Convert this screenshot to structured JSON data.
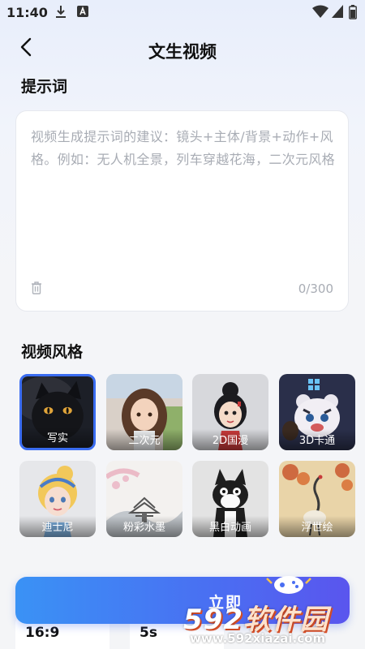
{
  "status_bar": {
    "time": "11:40"
  },
  "header": {
    "title": "文生视频"
  },
  "prompt": {
    "section_title": "提示词",
    "placeholder": "视频生成提示词的建议：镜头+主体/背景+动作+风格。例如：无人机全景，列车穿越花海，二次元风格",
    "char_count": "0/300"
  },
  "video_style": {
    "section_title": "视频风格",
    "selected": "写实",
    "items": [
      {
        "label": "写实"
      },
      {
        "label": "二次元"
      },
      {
        "label": "2D国漫"
      },
      {
        "label": "3D卡通"
      },
      {
        "label": "迪士尼"
      },
      {
        "label": "粉彩水墨"
      },
      {
        "label": "黑白动画"
      },
      {
        "label": "浮世绘"
      }
    ]
  },
  "bottom": {
    "create_label": "立即",
    "ratio_value": "16:9",
    "duration_value": "5s"
  },
  "watermark": {
    "logo_num": "592",
    "logo_name": "软件园",
    "url": "www.592xiazai.com"
  },
  "colors": {
    "accent": "#3a6cf0",
    "button_start": "#3a92f5",
    "button_end": "#5a55ee"
  }
}
